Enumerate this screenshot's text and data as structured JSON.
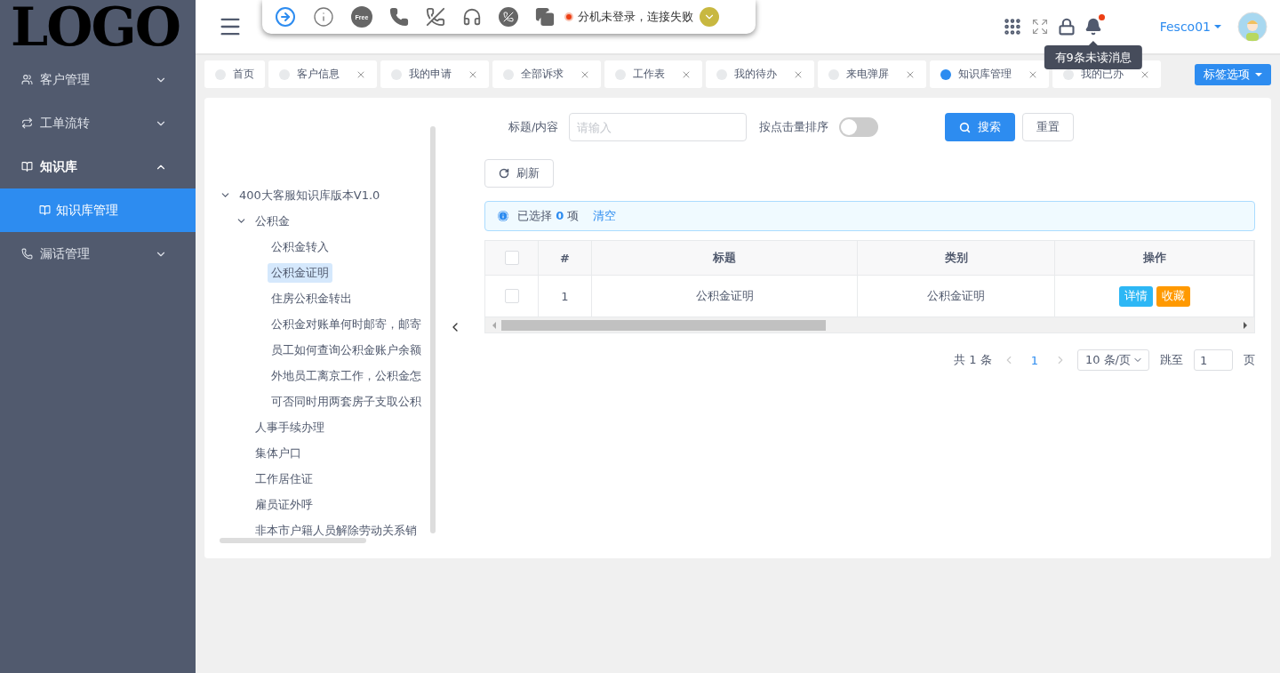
{
  "logo": "LOGO",
  "sidebar": {
    "items": [
      {
        "label": "客户管理",
        "expanded": false,
        "selected": false
      },
      {
        "label": "工单流转",
        "expanded": false,
        "selected": false
      },
      {
        "label": "知识库",
        "expanded": true,
        "selected": false,
        "children": [
          {
            "label": "知识库管理",
            "selected": true
          }
        ]
      },
      {
        "label": "漏话管理",
        "expanded": false,
        "selected": false
      }
    ]
  },
  "call_toolbar": {
    "free_badge": "Free",
    "status": {
      "connected": false,
      "text": "分机未登录，连接失败"
    }
  },
  "header": {
    "user": "Fesco01",
    "notifications": {
      "unread": true,
      "tooltip": "有9条未读消息"
    }
  },
  "tabs": [
    {
      "label": "首页",
      "selected": false,
      "closable": false
    },
    {
      "label": "客户信息",
      "selected": false,
      "closable": true
    },
    {
      "label": "我的申请",
      "selected": false,
      "closable": true
    },
    {
      "label": "全部诉求",
      "selected": false,
      "closable": true
    },
    {
      "label": "工作表",
      "selected": false,
      "closable": true
    },
    {
      "label": "我的待办",
      "selected": false,
      "closable": true
    },
    {
      "label": "来电弹屏",
      "selected": false,
      "closable": true
    },
    {
      "label": "知识库管理",
      "selected": true,
      "closable": true
    },
    {
      "label": "我的已办",
      "selected": false,
      "closable": true
    }
  ],
  "tab_options": "标签选项",
  "tree": [
    {
      "label": "400大客服知识库版本V1.0",
      "expanded": true,
      "selected": false,
      "children": [
        {
          "label": "公积金",
          "expanded": true,
          "selected": false,
          "children": [
            {
              "label": "公积金转入",
              "selected": false
            },
            {
              "label": "公积金证明",
              "selected": true
            },
            {
              "label": "住房公积金转出",
              "selected": false
            },
            {
              "label": "公积金对账单何时邮寄，邮寄",
              "selected": false
            },
            {
              "label": "员工如何查询公积金账户余额",
              "selected": false
            },
            {
              "label": "外地员工离京工作，公积金怎",
              "selected": false
            },
            {
              "label": "可否同时用两套房子支取公积",
              "selected": false
            }
          ]
        },
        {
          "label": "人事手续办理",
          "selected": false
        },
        {
          "label": "集体户口",
          "selected": false
        },
        {
          "label": "工作居住证",
          "selected": false
        },
        {
          "label": "雇员证外呼",
          "selected": false
        },
        {
          "label": "非本市户籍人员解除劳动关系销",
          "selected": false
        }
      ]
    }
  ],
  "filters": {
    "search_field": {
      "label": "标题/内容",
      "placeholder": "请输入"
    },
    "sort_switch": {
      "label": "按点击量排序",
      "on": false
    },
    "search_button": "搜索",
    "reset_button": "重置"
  },
  "refresh_button": "刷新",
  "selection_alert": {
    "text": "已选择 **0** 项",
    "clear": "清空"
  },
  "table": {
    "header_checked": false,
    "columns": [
      "#",
      "标题",
      "类别",
      "操作"
    ],
    "rows": [
      {
        "checked": false,
        "index": "1",
        "title": "公积金证明",
        "category": "公积金证明",
        "actions": [
          {
            "kind": "info",
            "label": "详情"
          },
          {
            "kind": "warning",
            "label": "收藏"
          }
        ]
      }
    ]
  },
  "pagination": {
    "total": "共 1 条",
    "pages": [
      {
        "label": "1",
        "selected": true
      }
    ],
    "page_size": "10 条/页",
    "jump_label": "跳至",
    "jump_value": "1",
    "page_suffix": "页"
  }
}
